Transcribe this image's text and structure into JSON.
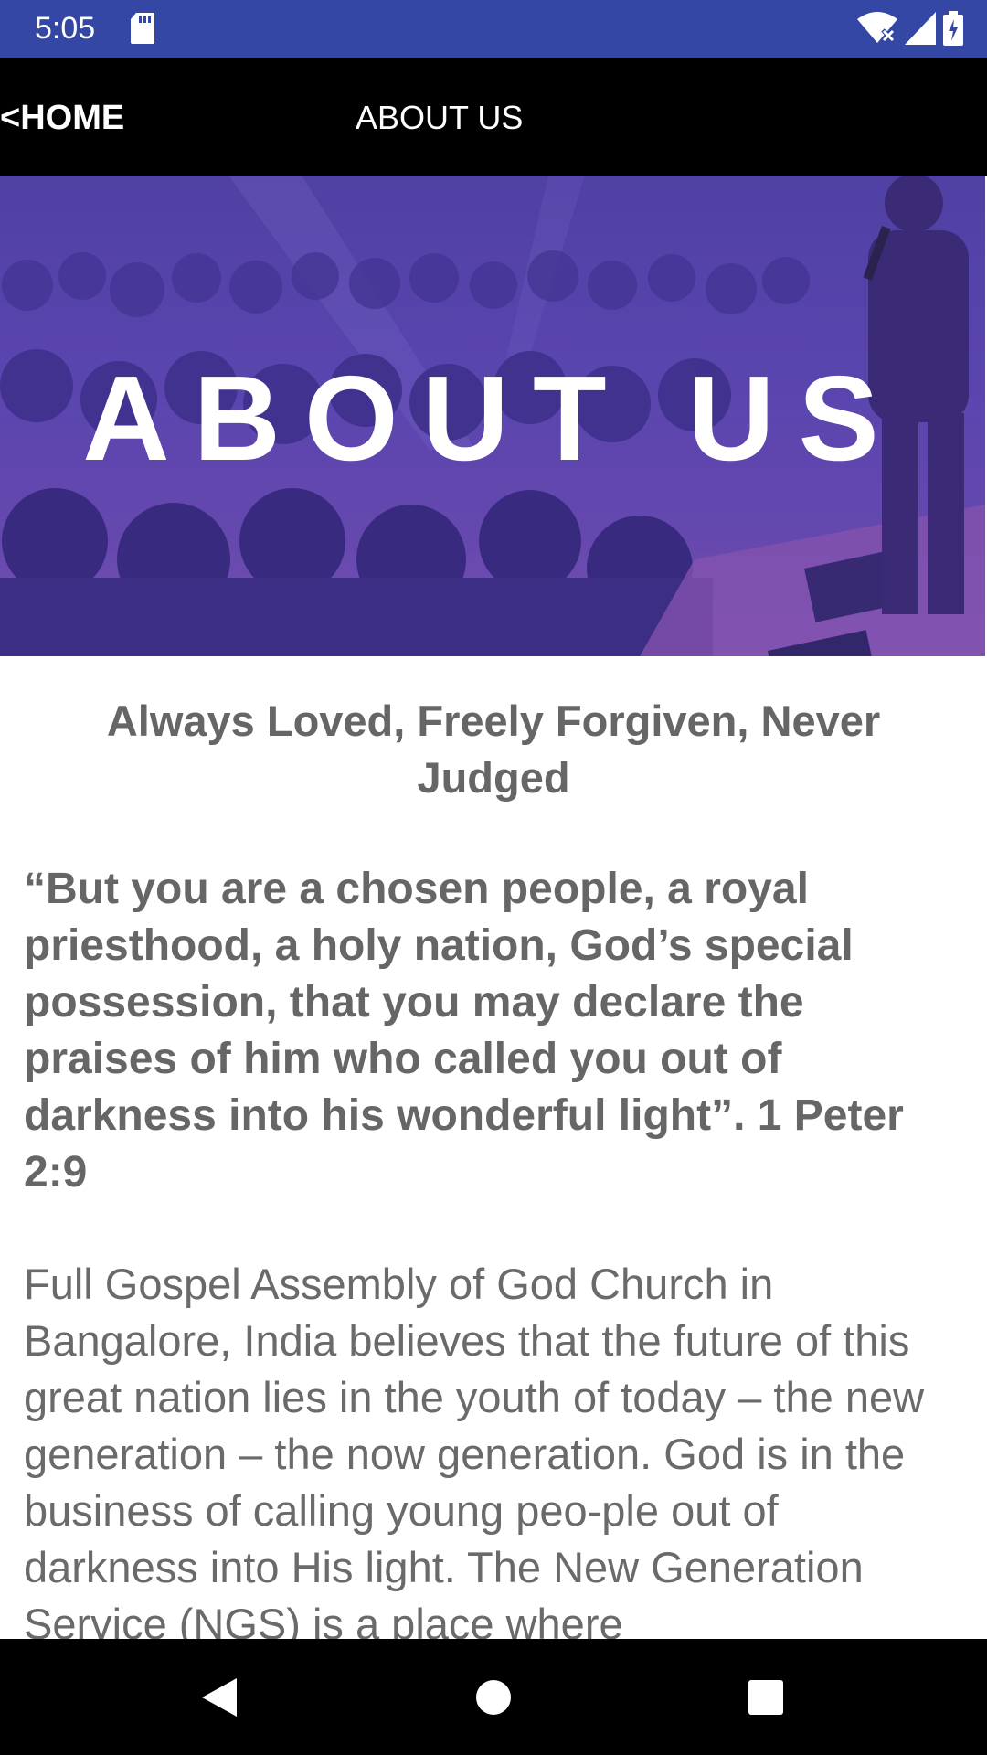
{
  "status_bar": {
    "time": "5:05",
    "icons": [
      "sd-card-icon",
      "wifi-icon",
      "signal-icon",
      "battery-icon"
    ]
  },
  "app_bar": {
    "home_label": "<HOME",
    "title": "ABOUT US"
  },
  "hero": {
    "title": "ABOUT US"
  },
  "content": {
    "tagline": "Always Loved, Freely Forgiven, Never Judged",
    "verse": "“But you are a chosen people, a royal priesthood, a holy nation, God’s special possession, that you may declare the praises of him who called you out of darkness into his wonderful light”. 1 Peter 2:9",
    "body": "Full Gospel Assembly of God Church in Bangalore, India believes that the future of this great nation lies in the youth of today – the new generation – the now generation. God is in the business of calling young peo-ple out of darkness into His light. The New Generation Service (NGS) is a place where"
  },
  "nav_bar": {
    "icons": [
      "back-icon",
      "home-icon",
      "recents-icon"
    ]
  },
  "colors": {
    "status_bar": "#3447a5",
    "app_bar": "#000000",
    "text_gray": "#666666"
  }
}
